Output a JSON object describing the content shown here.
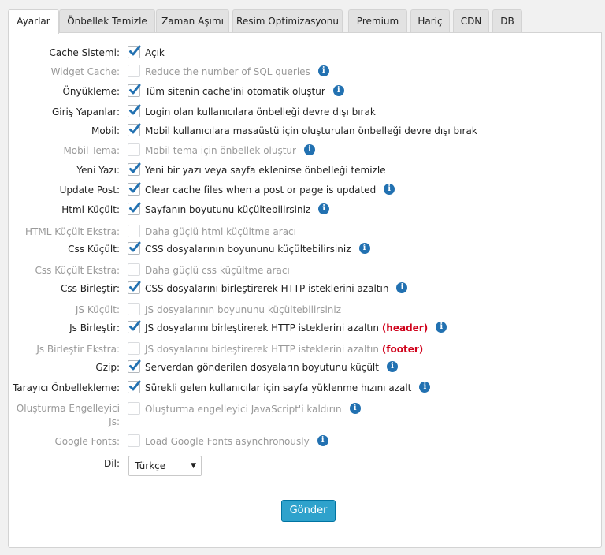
{
  "tabs": [
    {
      "label": "Ayarlar",
      "active": true
    },
    {
      "label": "Önbellek Temizle",
      "active": false
    },
    {
      "label": "Zaman Aşımı",
      "active": false
    },
    {
      "label": "Resim Optimizasyonu",
      "active": false
    },
    {
      "label": "Premium",
      "active": false
    },
    {
      "label": "Hariç",
      "active": false
    },
    {
      "label": "CDN",
      "active": false
    },
    {
      "label": "DB",
      "active": false
    }
  ],
  "settings": [
    {
      "label": "Cache Sistemi:",
      "text": "Açık",
      "checked": true,
      "dim": false,
      "info": false
    },
    {
      "label": "Widget Cache:",
      "text": "Reduce the number of SQL queries",
      "checked": false,
      "dim": true,
      "info": true
    },
    {
      "label": "Önyükleme:",
      "text": "Tüm sitenin cache'ini otomatik oluştur",
      "checked": true,
      "dim": false,
      "info": true
    },
    {
      "label": "Giriş Yapanlar:",
      "text": "Login olan kullanıcılara önbelleği devre dışı bırak",
      "checked": true,
      "dim": false,
      "info": false
    },
    {
      "label": "Mobil:",
      "text": "Mobil kullanıcılara masaüstü için oluşturulan önbelleği devre dışı bırak",
      "checked": true,
      "dim": false,
      "info": false
    },
    {
      "label": "Mobil Tema:",
      "text": "Mobil tema için önbellek oluştur",
      "checked": false,
      "dim": true,
      "info": true
    },
    {
      "label": "Yeni Yazı:",
      "text": "Yeni bir yazı veya sayfa eklenirse önbelleği temizle",
      "checked": true,
      "dim": false,
      "info": false
    },
    {
      "label": "Update Post:",
      "text": "Clear cache files when a post or page is updated",
      "checked": true,
      "dim": false,
      "info": true
    },
    {
      "label": "Html Küçült:",
      "text": "Sayfanın boyutunu küçültebilirsiniz",
      "checked": true,
      "dim": false,
      "info": true
    },
    {
      "label": "HTML Küçült Ekstra:",
      "text": "Daha güçlü html küçültme aracı",
      "checked": false,
      "dim": true,
      "info": false
    },
    {
      "label": "Css Küçült:",
      "text": "CSS dosyalarının boyununu küçültebilirsiniz",
      "checked": true,
      "dim": false,
      "info": true
    },
    {
      "label": "Css Küçült Ekstra:",
      "text": "Daha güçlü css küçültme aracı",
      "checked": false,
      "dim": true,
      "info": false
    },
    {
      "label": "Css Birleştir:",
      "text": "CSS dosyalarını birleştirerek HTTP isteklerini azaltın",
      "checked": true,
      "dim": false,
      "info": true
    },
    {
      "label": "JS Küçült:",
      "text": "JS dosyalarının boyununu küçültebilirsiniz",
      "checked": false,
      "dim": true,
      "info": false
    },
    {
      "label": "Js Birleştir:",
      "text": "JS dosyalarını birleştirerek HTTP isteklerini azaltın",
      "tag": "(header)",
      "checked": true,
      "dim": false,
      "info": true
    },
    {
      "label": "Js Birleştir Ekstra:",
      "text": "JS dosyalarını birleştirerek HTTP isteklerini azaltın",
      "tag": "(footer)",
      "checked": false,
      "dim": true,
      "info": false
    },
    {
      "label": "Gzip:",
      "text": "Serverdan gönderilen dosyaların boyutunu küçült",
      "checked": true,
      "dim": false,
      "info": true
    },
    {
      "label": "Tarayıcı Önbellekleme:",
      "text": "Sürekli gelen kullanıcılar için sayfa yüklenme hızını azalt",
      "checked": true,
      "dim": false,
      "info": true
    },
    {
      "label": "Oluşturma Engelleyici Js:",
      "label_line1": "Oluşturma Engelleyici",
      "label_line2": "Js:",
      "text": "Oluşturma engelleyici JavaScript'i kaldırın",
      "checked": false,
      "dim": true,
      "info": true
    },
    {
      "label": "Google Fonts:",
      "text": "Load Google Fonts asynchronously",
      "checked": false,
      "dim": true,
      "info": true
    }
  ],
  "language": {
    "label": "Dil:",
    "value": "Türkçe"
  },
  "submit_label": "Gönder",
  "colors": {
    "accent": "#2271b1",
    "button": "#2ea2cc",
    "tag_red": "#d0021b"
  }
}
